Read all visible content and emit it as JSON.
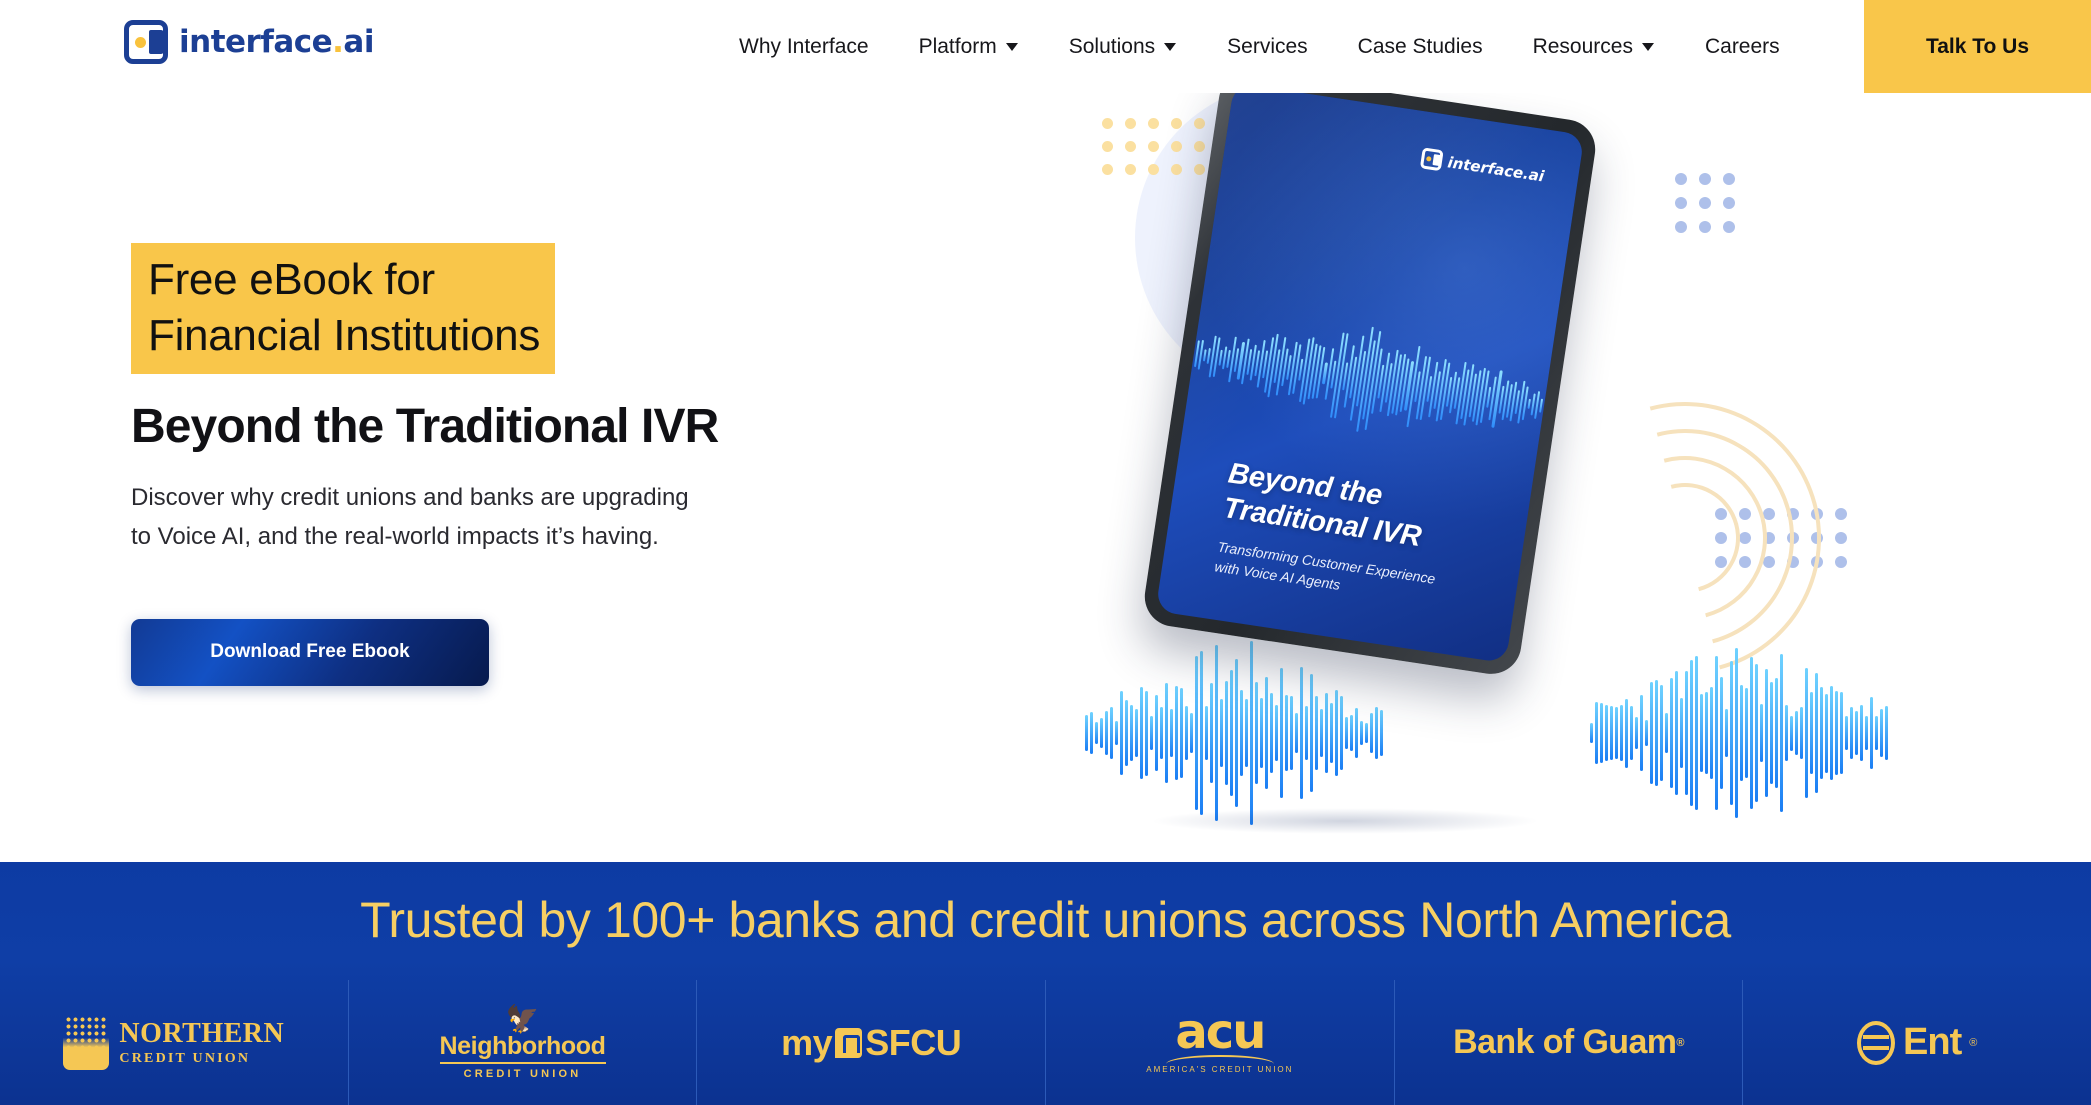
{
  "header": {
    "logo": {
      "text": "interface",
      "period": ".",
      "tld": "ai",
      "icon": "interface-ai-logo"
    },
    "nav": [
      {
        "label": "Why Interface",
        "has_dropdown": false
      },
      {
        "label": "Platform",
        "has_dropdown": true
      },
      {
        "label": "Solutions",
        "has_dropdown": true
      },
      {
        "label": "Services",
        "has_dropdown": false
      },
      {
        "label": "Case Studies",
        "has_dropdown": false
      },
      {
        "label": "Resources",
        "has_dropdown": true
      },
      {
        "label": "Careers",
        "has_dropdown": false
      }
    ],
    "cta": {
      "label": "Talk To Us",
      "bg": "#f9c64a"
    }
  },
  "hero": {
    "eyebrow_line1": "Free eBook for",
    "eyebrow_line2": "Financial Institutions",
    "eyebrow_bg": "#f9c64a",
    "headline": "Beyond the Traditional IVR",
    "sub_line1": "Discover why credit unions and banks are upgrading",
    "sub_line2": "to Voice AI, and the real-world impacts it’s having.",
    "button": {
      "label": "Download Free Ebook",
      "bg_start": "#123a94",
      "bg_end": "#071a4d"
    },
    "tablet": {
      "logo_text": "interface.ai",
      "cover_title_line1": "Beyond the",
      "cover_title_line2": "Traditional IVR",
      "cover_sub_line1": "Transforming Customer Experience",
      "cover_sub_line2": "with Voice AI Agents"
    },
    "carousel": {
      "total": 3,
      "active_index": 1,
      "active_color": "#f5b827",
      "inactive_color": "#fbeac2"
    }
  },
  "banner": {
    "title": "Trusted by 100+ banks and credit unions across North America",
    "bg": "#0d3ba3",
    "title_color": "#f7cf63",
    "logos": [
      {
        "name": "northern-credit-union",
        "line1": "NORTHERN",
        "line2": "CREDIT UNION"
      },
      {
        "name": "neighborhood-credit-union",
        "line1": "Neighborhood",
        "line2": "CREDIT UNION"
      },
      {
        "name": "mysfcu",
        "prefix": "my",
        "suffix": "SFCU"
      },
      {
        "name": "acu-americas-credit-union",
        "line1": "acu",
        "line2": "AMERICA'S CREDIT UNION"
      },
      {
        "name": "bank-of-guam",
        "line1": "Bank of Guam"
      },
      {
        "name": "ent-credit-union",
        "line1": "Ent"
      }
    ]
  }
}
